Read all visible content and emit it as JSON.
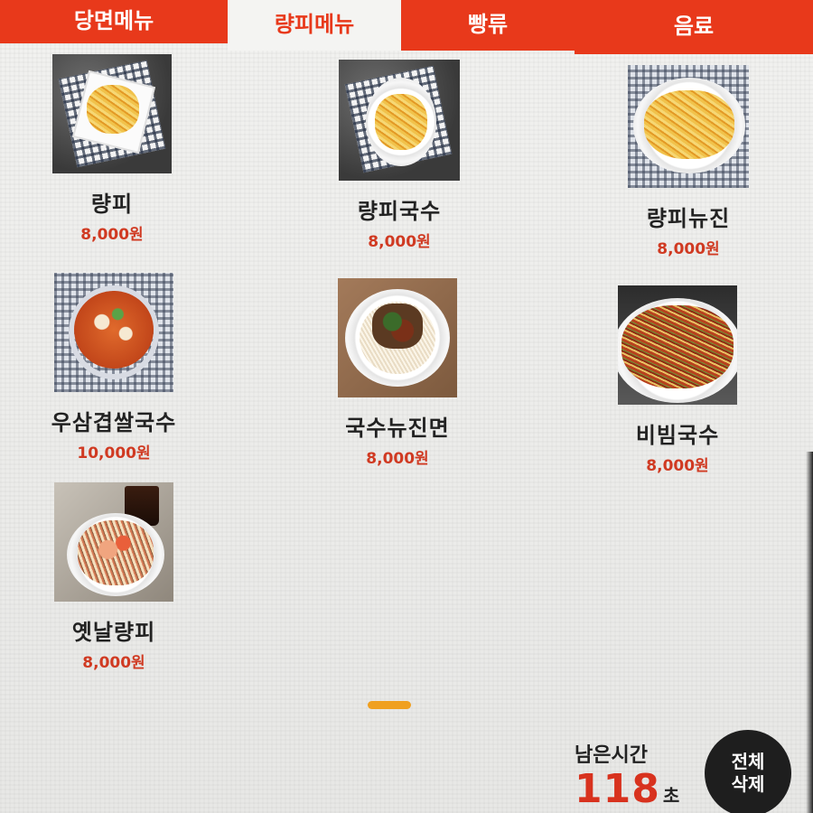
{
  "tabs": [
    {
      "label": "당면메뉴",
      "selected": false
    },
    {
      "label": "량피메뉴",
      "selected": true
    },
    {
      "label": "빵류",
      "selected": false
    },
    {
      "label": "음료",
      "selected": false
    }
  ],
  "menu_items": [
    {
      "name": "량피",
      "price": "8,000원"
    },
    {
      "name": "량피국수",
      "price": "8,000원"
    },
    {
      "name": "량피뉴진",
      "price": "8,000원"
    },
    {
      "name": "우삼겹쌀국수",
      "price": "10,000원"
    },
    {
      "name": "국수뉴진면",
      "price": "8,000원"
    },
    {
      "name": "비빔국수",
      "price": "8,000원"
    },
    {
      "name": "옛날량피",
      "price": "8,000원"
    }
  ],
  "timer": {
    "label": "남은시간",
    "seconds": "118",
    "unit": "초"
  },
  "clear_all": {
    "line1": "전체",
    "line2": "삭제"
  },
  "colors": {
    "accent": "#e8391b",
    "price": "#d03a22",
    "pager": "#f0a020"
  }
}
